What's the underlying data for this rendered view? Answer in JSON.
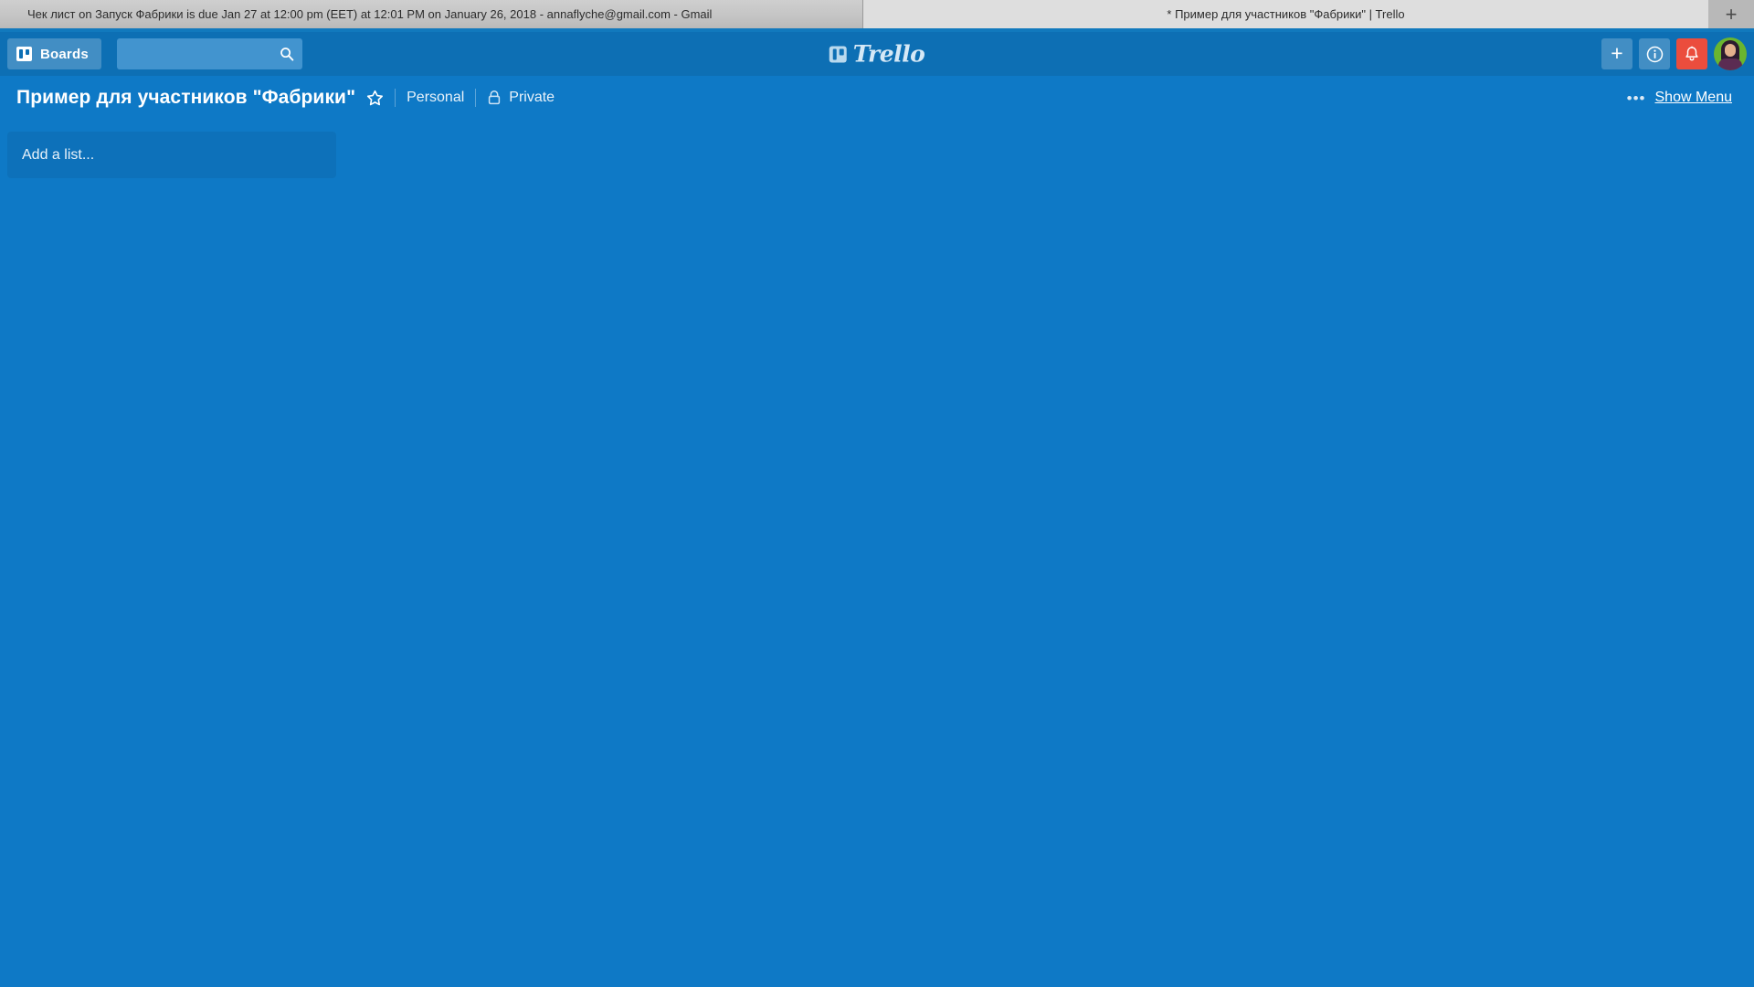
{
  "browser": {
    "tabs": [
      {
        "title": "Чек лист on Запуск Фабрики is due Jan 27 at 12:00 pm (EET) at 12:01 PM on January 26, 2018 - annaflyche@gmail.com - Gmail",
        "active": false
      },
      {
        "title": "* Пример для участников \"Фабрики\" | Trello",
        "active": true
      }
    ],
    "new_tab_label": "+",
    "new_tab_icon": "plus-icon"
  },
  "topnav": {
    "boards_label": "Boards",
    "boards_icon": "board-icon",
    "search": {
      "value": "",
      "placeholder": "",
      "icon": "search-icon"
    },
    "logo_text": "Trello",
    "logo_icon": "trello-logo-icon",
    "actions": [
      {
        "name": "add-button",
        "icon": "plus-icon",
        "label": "+"
      },
      {
        "name": "info-button",
        "icon": "info-icon",
        "label": "i"
      },
      {
        "name": "notifications-button",
        "icon": "bell-icon",
        "label": ""
      }
    ],
    "avatar_alt": "User avatar"
  },
  "board_header": {
    "title": "Пример для участников \"Фабрики\"",
    "star_icon": "star-icon",
    "team_label": "Personal",
    "visibility_label": "Private",
    "visibility_icon": "lock-icon",
    "more_dots": "•••",
    "show_menu_label": "Show Menu"
  },
  "canvas": {
    "add_list_label": "Add a list..."
  },
  "colors": {
    "board_background": "#0e79c6",
    "nav_background": "#0d6fb4",
    "search_background": "#4294cf",
    "notification_red": "#eb4d3d",
    "tabstrip_background": "#b8b8b8",
    "active_tab": "#dedede",
    "inactive_tab": "#c4c4c4"
  }
}
